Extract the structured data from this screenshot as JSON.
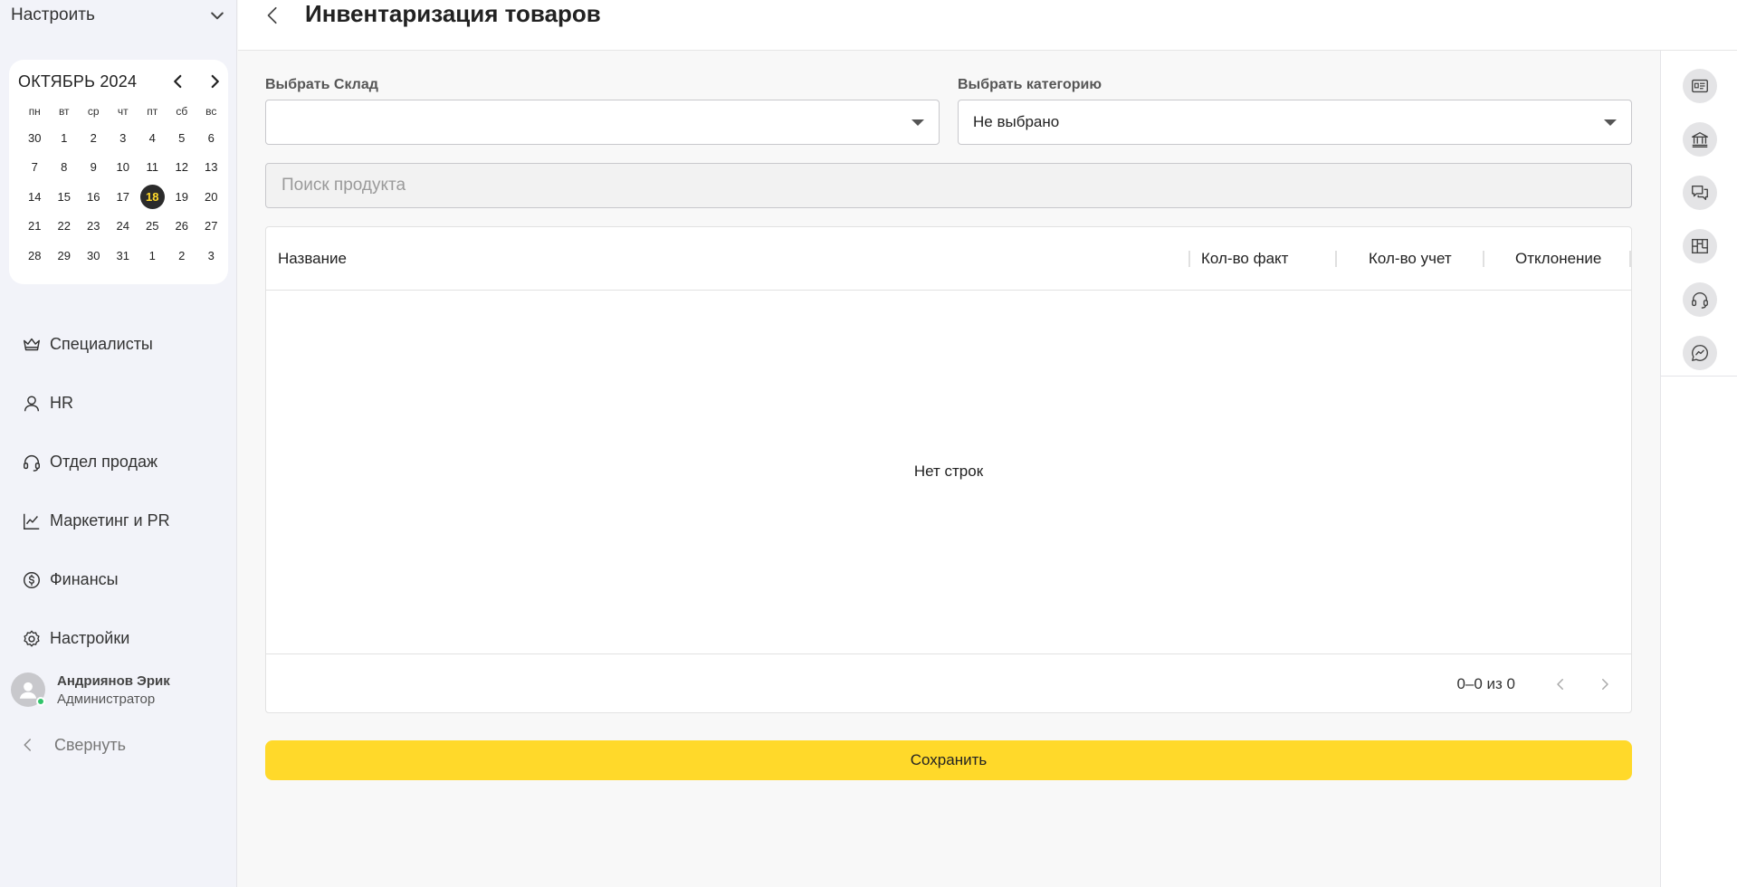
{
  "sidebar": {
    "setup_label": "Настроить",
    "calendar": {
      "title": "ОКТЯБРЬ 2024",
      "weekdays": [
        "пн",
        "вт",
        "ср",
        "чт",
        "пт",
        "сб",
        "вс"
      ],
      "days": [
        "30",
        "1",
        "2",
        "3",
        "4",
        "5",
        "6",
        "7",
        "8",
        "9",
        "10",
        "11",
        "12",
        "13",
        "14",
        "15",
        "16",
        "17",
        "18",
        "19",
        "20",
        "21",
        "22",
        "23",
        "24",
        "25",
        "26",
        "27",
        "28",
        "29",
        "30",
        "31",
        "1",
        "2",
        "3"
      ],
      "today": "18"
    },
    "nav": [
      {
        "label": "Специалисты",
        "icon": "crown-icon"
      },
      {
        "label": "HR",
        "icon": "user-icon"
      },
      {
        "label": "Отдел продаж",
        "icon": "headset-icon"
      },
      {
        "label": "Маркетинг и PR",
        "icon": "chart-line-icon"
      },
      {
        "label": "Финансы",
        "icon": "dollar-circle-icon"
      },
      {
        "label": "Настройки",
        "icon": "gear-icon"
      }
    ],
    "user": {
      "name": "Андриянов Эрик",
      "role": "Администратор"
    },
    "collapse_label": "Свернуть"
  },
  "header": {
    "title": "Инвентаризация товаров"
  },
  "filters": {
    "warehouse_label": "Выбрать Склад",
    "warehouse_value": "",
    "category_label": "Выбрать категорию",
    "category_value": "Не выбрано"
  },
  "search": {
    "placeholder": "Поиск продукта"
  },
  "table": {
    "columns": [
      "Название",
      "Кол-во факт",
      "Кол-во учет",
      "Отклонение"
    ],
    "empty_text": "Нет строк",
    "pagination": "0–0 из 0"
  },
  "save_label": "Сохранить",
  "rail": [
    "id-card-icon",
    "bank-icon",
    "chat-icon",
    "kanban-icon",
    "headset-icon",
    "messenger-icon"
  ]
}
